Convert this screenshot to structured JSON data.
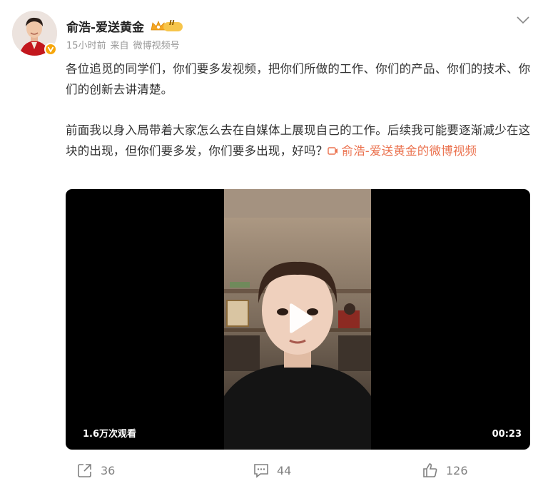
{
  "author": {
    "name": "俞浩-爱送黄金",
    "badge_level": "II"
  },
  "post_meta": {
    "time": "15小时前",
    "source_prefix": "来自",
    "source": "微博视频号"
  },
  "post": {
    "paragraph1": "各位追觅的同学们，你们要多发视频，把你们所做的工作、你们的产品、你们的技术、你们的创新去讲清楚。",
    "paragraph2": "前面我以身入局带着大家怎么去在自媒体上展现自己的工作。后续我可能要逐渐减少在这块的出现，但你们要多发，你们要多出现，好吗？",
    "video_link": "俞浩-爱送黄金的微博视频"
  },
  "video": {
    "views": "1.6万次观看",
    "duration": "00:23"
  },
  "actions": {
    "reposts": "36",
    "comments": "44",
    "likes": "126"
  },
  "colors": {
    "link": "#eb7350",
    "verified": "#f6a60b",
    "meta_gray": "#999999"
  }
}
